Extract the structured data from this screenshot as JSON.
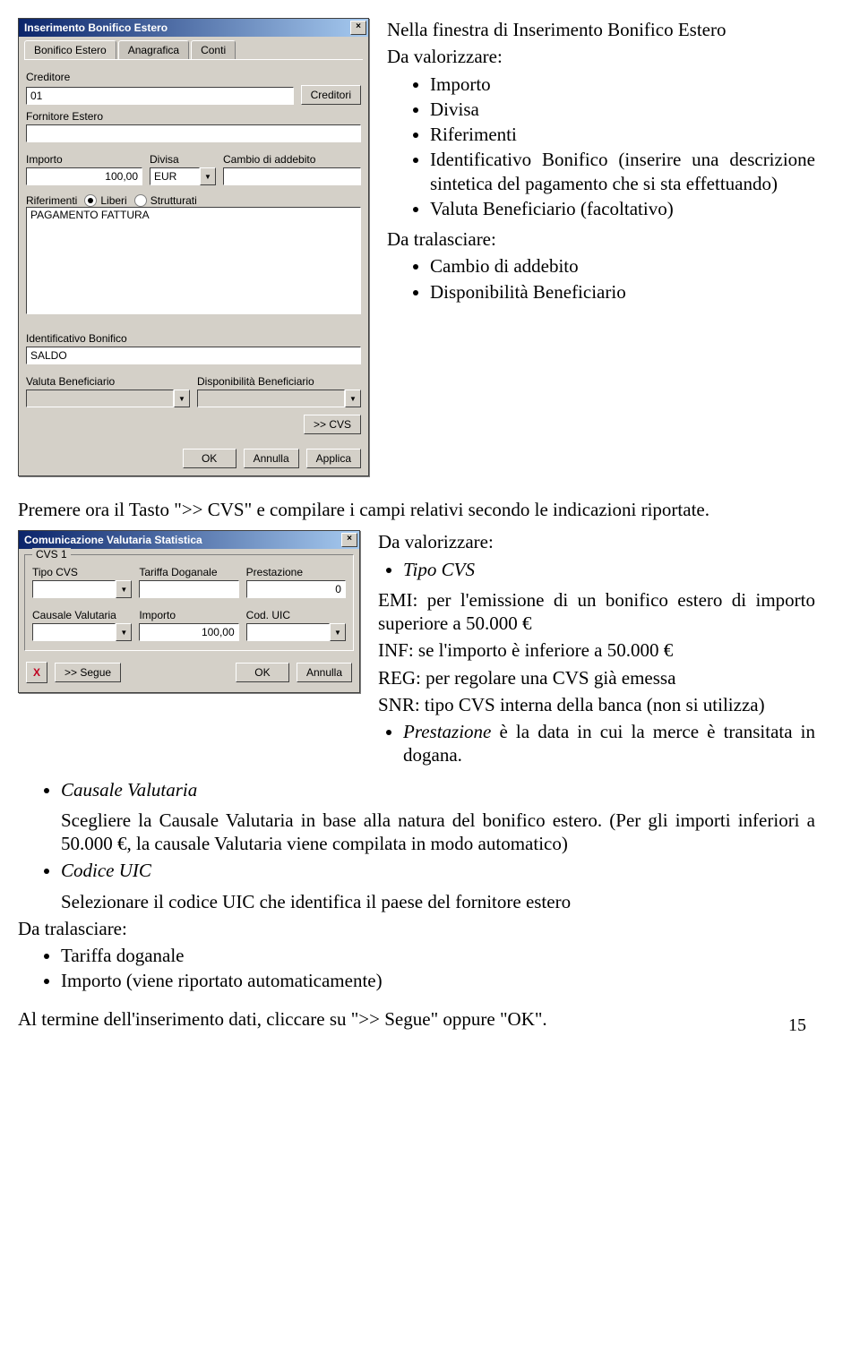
{
  "dialog1": {
    "title": "Inserimento Bonifico Estero",
    "close": "×",
    "tabs": [
      "Bonifico Estero",
      "Anagrafica",
      "Conti"
    ],
    "labels": {
      "creditore": "Creditore",
      "fornitore": "Fornitore Estero",
      "importo": "Importo",
      "divisa": "Divisa",
      "cambio": "Cambio di addebito",
      "riferimenti": "Riferimenti",
      "ident": "Identificativo Bonifico",
      "valutaBen": "Valuta Beneficiario",
      "dispBen": "Disponibilità Beneficiario"
    },
    "values": {
      "creditore": "01",
      "importo": "100,00",
      "divisa": "EUR",
      "riferimenti": "PAGAMENTO FATTURA",
      "ident": "SALDO"
    },
    "radios": {
      "liberi": "Liberi",
      "strutturati": "Strutturati"
    },
    "buttons": {
      "creditori": "Creditori",
      "cvs": ">> CVS",
      "ok": "OK",
      "annulla": "Annulla",
      "applica": "Applica"
    }
  },
  "text1": {
    "para1": "Nella finestra di Inserimento Bonifico Estero",
    "daValorizzare": "Da valorizzare:",
    "bullets1": [
      "Importo",
      "Divisa",
      "Riferimenti",
      "Identificativo Bonifico (inserire una descrizione sintetica del pagamento che si sta effettuando)",
      "Valuta Beneficiario (facoltativo)"
    ],
    "daTralasciare": "Da tralasciare:",
    "bullets2": [
      "Cambio di addebito",
      "Disponibilità Beneficiario"
    ]
  },
  "midPara": "Premere ora il Tasto \">> CVS\" e compilare i campi relativi secondo le indicazioni riportate.",
  "dialog2": {
    "title": "Comunicazione Valutaria Statistica",
    "close": "×",
    "legend": "CVS 1",
    "labels": {
      "tipo": "Tipo CVS",
      "tariffa": "Tariffa Doganale",
      "prestazione": "Prestazione",
      "causale": "Causale Valutaria",
      "importo": "Importo",
      "cod": "Cod. UIC"
    },
    "values": {
      "prestazione": "0",
      "importo": "100,00"
    },
    "buttons": {
      "x": "X",
      "segue": ">> Segue",
      "ok": "OK",
      "annulla": "Annulla"
    }
  },
  "text2": {
    "daValorizzare": "Da valorizzare:",
    "tipoHeader": "Tipo CVS",
    "tipoLines": [
      "EMI: per l'emissione di un bonifico estero di importo superiore a 50.000 €",
      "INF: se l'importo è inferiore a 50.000 €",
      "REG: per regolare una CVS già emessa",
      "SNR: tipo CVS interna della banca (non si utilizza)"
    ],
    "prestazione": "Prestazione",
    "prestazioneRest": " è la data in cui la merce è transitata in dogana.",
    "causale": "Causale Valutaria",
    "causaleExpl": "Scegliere la Causale Valutaria in base alla natura del bonifico estero. (Per gli importi inferiori a 50.000 €, la causale Valutaria viene compilata in modo automatico)",
    "codice": "Codice UIC",
    "codiceExpl": "Selezionare il  codice UIC che identifica il paese del fornitore estero",
    "daTralasciare": "Da tralasciare:",
    "tralBullets": [
      "Tariffa doganale",
      "Importo (viene riportato automaticamente)"
    ],
    "final": "Al termine dell'inserimento dati, cliccare su \">> Segue\" oppure \"OK\"."
  },
  "pageNumber": "15"
}
